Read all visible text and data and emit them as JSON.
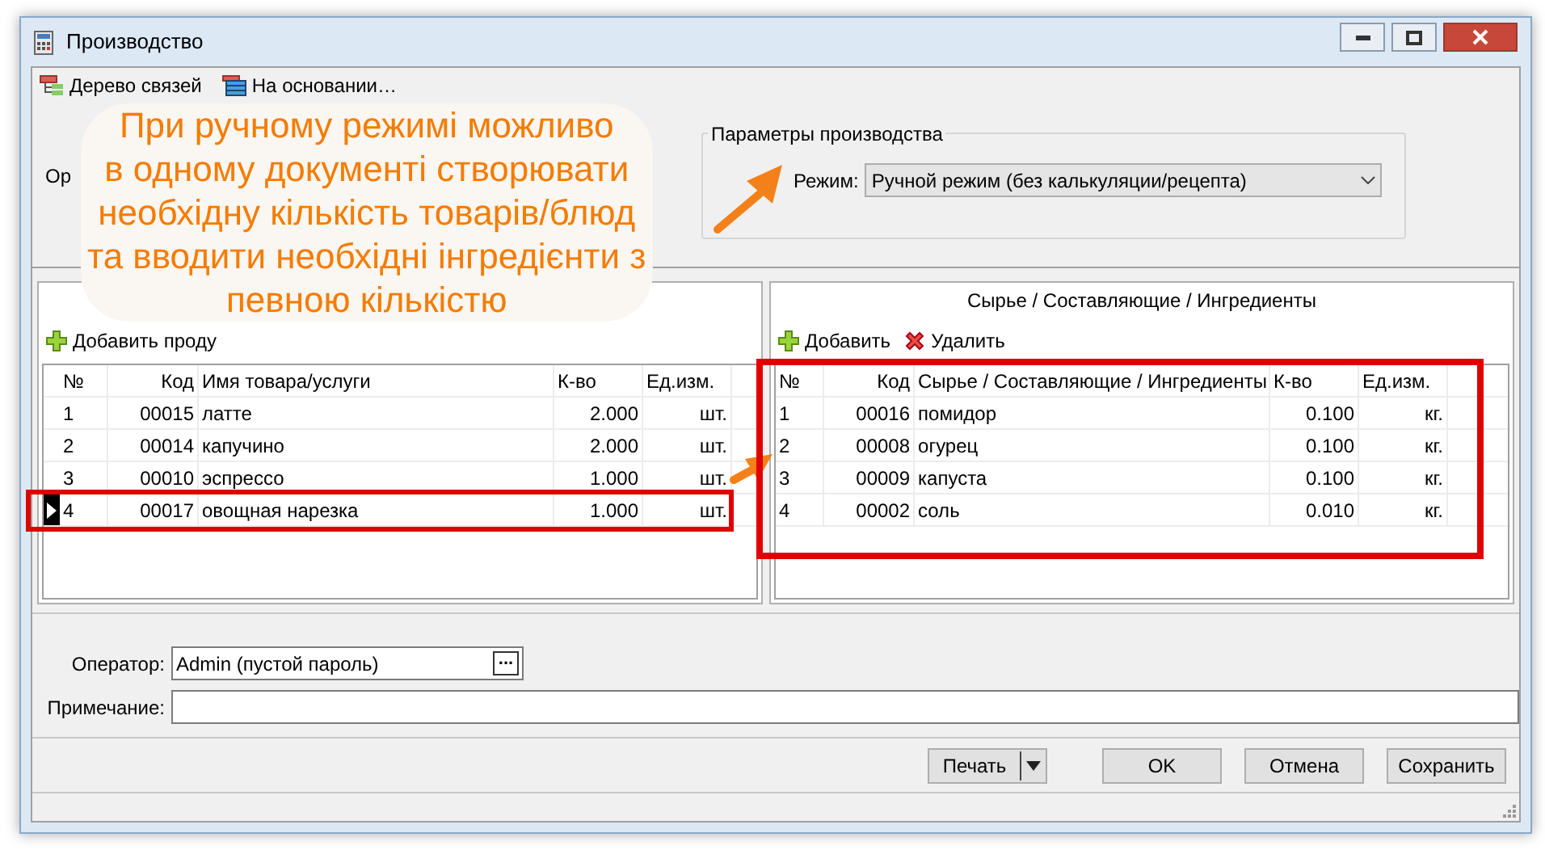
{
  "window": {
    "title": "Производство"
  },
  "toolbar": [
    "Дерево связей",
    "На основании…"
  ],
  "operation_label": "Ор",
  "params": {
    "title": "Параметры производства",
    "mode_label": "Режим:",
    "mode_value": "Ручной режим (без калькуляции/рецепта)"
  },
  "products": {
    "add_button": "Добавить проду",
    "columns": [
      "№",
      "Код",
      "Имя товара/услуги",
      "К-во",
      "Ед.изм."
    ],
    "rows": [
      {
        "cells": [
          "1",
          "00015",
          "латте",
          "2.000",
          "шт."
        ],
        "selected": false
      },
      {
        "cells": [
          "2",
          "00014",
          "капучино",
          "2.000",
          "шт."
        ],
        "selected": false
      },
      {
        "cells": [
          "3",
          "00010",
          "эспрессо",
          "1.000",
          "шт."
        ],
        "selected": false
      },
      {
        "cells": [
          "4",
          "00017",
          "овощная нарезка",
          "1.000",
          "шт."
        ],
        "selected": true
      }
    ]
  },
  "ingredients": {
    "title": "Сырье / Составляющие / Ингредиенты",
    "add_button": "Добавить",
    "delete_button": "Удалить",
    "columns": [
      "№",
      "Код",
      "Сырье / Составляющие / Ингредиенты",
      "К-во",
      "Ед.изм."
    ],
    "rows": [
      {
        "cells": [
          "1",
          "00016",
          "помидор",
          "0.100",
          "кг."
        ]
      },
      {
        "cells": [
          "2",
          "00008",
          "огурец",
          "0.100",
          "кг."
        ]
      },
      {
        "cells": [
          "3",
          "00009",
          "капуста",
          "0.100",
          "кг."
        ]
      },
      {
        "cells": [
          "4",
          "00002",
          "соль",
          "0.010",
          "кг."
        ]
      }
    ]
  },
  "operator": {
    "label": "Оператор:",
    "value": "Admin (пустой пароль)",
    "browse": "..."
  },
  "note": {
    "label": "Примечание:"
  },
  "buttons": [
    {
      "label": "Печать",
      "kind": "split"
    },
    {
      "label": "OK",
      "kind": "plain"
    },
    {
      "label": "Отмена",
      "kind": "plain"
    },
    {
      "label": "Сохранить",
      "kind": "plain"
    }
  ],
  "annotation": {
    "lines": [
      "При ручному режимі можливо",
      "в одному документі створювати",
      "необхідну кількість товарів/блюд",
      "та вводити необхідні інгредієнти з",
      "певною кількістю"
    ]
  }
}
